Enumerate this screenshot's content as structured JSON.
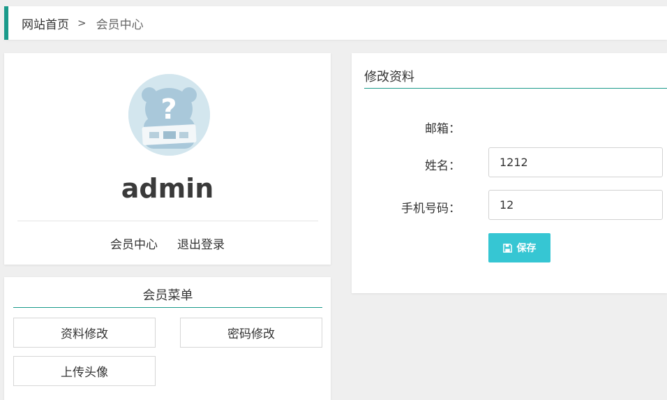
{
  "breadcrumb": {
    "home": "网站首页",
    "separator": ">",
    "current": "会员中心"
  },
  "profile": {
    "avatar_icon": "bear-placeholder-avatar",
    "username": "admin",
    "links": {
      "center": "会员中心",
      "logout": "退出登录"
    }
  },
  "member_menu": {
    "title": "会员菜单",
    "items": [
      "资料修改",
      "密码修改",
      "上传头像"
    ]
  },
  "edit_profile": {
    "title": "修改资料",
    "email_label": "邮箱：",
    "email_value": "",
    "name_label": "姓名：",
    "name_value": "1212",
    "phone_label": "手机号码：",
    "phone_value": "12",
    "save_label": "保存"
  },
  "colors": {
    "accent": "#1a9a8a",
    "button": "#36c6d3",
    "background": "#efefef"
  }
}
